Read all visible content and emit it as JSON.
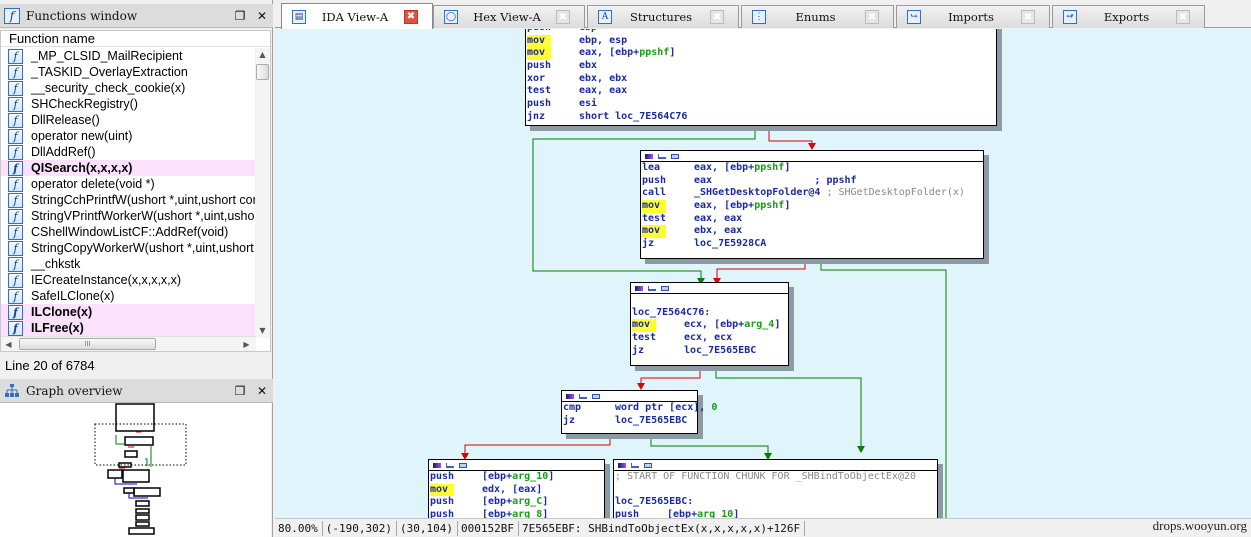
{
  "functions_window": {
    "title": "Functions window",
    "column_header": "Function name",
    "rows": [
      {
        "name": "_MP_CLSID_MailRecipient",
        "highlight": false
      },
      {
        "name": "_TASKID_OverlayExtraction",
        "highlight": false
      },
      {
        "name": "__security_check_cookie(x)",
        "highlight": false
      },
      {
        "name": "SHCheckRegistry()",
        "highlight": false
      },
      {
        "name": "DllRelease()",
        "highlight": false
      },
      {
        "name": "operator new(uint)",
        "highlight": false
      },
      {
        "name": "DllAddRef()",
        "highlight": false
      },
      {
        "name": "QISearch(x,x,x,x)",
        "highlight": true
      },
      {
        "name": "operator delete(void *)",
        "highlight": false
      },
      {
        "name": "StringCchPrintfW(ushort *,uint,ushort const *,...)",
        "highlight": false
      },
      {
        "name": "StringVPrintfWorkerW(ushort *,uint,ushort *,ushort const *,char *)",
        "highlight": false
      },
      {
        "name": "CShellWindowListCF::AddRef(void)",
        "highlight": false
      },
      {
        "name": "StringCopyWorkerW(ushort *,uint,ushort const *)",
        "highlight": false
      },
      {
        "name": "__chkstk",
        "highlight": false
      },
      {
        "name": "IECreateInstance(x,x,x,x,x)",
        "highlight": false
      },
      {
        "name": "SafeILClone(x)",
        "highlight": false
      },
      {
        "name": "ILClone(x)",
        "highlight": true
      },
      {
        "name": "ILFree(x)",
        "highlight": true
      }
    ],
    "status": "Line 20 of 6784",
    "icon": "function-icon"
  },
  "graph_overview": {
    "title": "Graph overview",
    "icon": "graph-tree-icon"
  },
  "tabs": [
    {
      "label": "IDA View-A",
      "icon": "ida-view-icon",
      "active": true
    },
    {
      "label": "Hex View-A",
      "icon": "hex-view-icon",
      "active": false
    },
    {
      "label": "Structures",
      "icon": "structures-icon",
      "active": false
    },
    {
      "label": "Enums",
      "icon": "enums-icon",
      "active": false
    },
    {
      "label": "Imports",
      "icon": "imports-icon",
      "active": false
    },
    {
      "label": "Exports",
      "icon": "exports-icon",
      "active": false
    }
  ],
  "graph": {
    "nodes": {
      "n1": {
        "lines": [
          {
            "mn": "push",
            "ops": [
              {
                "t": "ebp"
              }
            ]
          },
          {
            "mn": "mov",
            "ops": [
              {
                "t": "ebp, esp"
              }
            ]
          },
          {
            "mn": "mov",
            "ops": [
              {
                "t": "eax, [ebp+"
              },
              {
                "t": "ppshf",
                "c": "var"
              },
              {
                "t": "]"
              }
            ]
          },
          {
            "mn": "push",
            "ops": [
              {
                "t": "ebx"
              }
            ]
          },
          {
            "mn": "xor",
            "ops": [
              {
                "t": "ebx, ebx"
              }
            ]
          },
          {
            "mn": "test",
            "ops": [
              {
                "t": "eax, eax"
              }
            ]
          },
          {
            "mn": "push",
            "ops": [
              {
                "t": "esi"
              }
            ]
          },
          {
            "mn": "jnz",
            "ops": [
              {
                "t": "short loc_7E564C76"
              }
            ]
          }
        ]
      },
      "n2": {
        "lines": [
          {
            "mn": "lea",
            "ops": [
              {
                "t": "eax, [ebp+"
              },
              {
                "t": "ppshf",
                "c": "var"
              },
              {
                "t": "]"
              }
            ]
          },
          {
            "mn": "push",
            "ops": [
              {
                "t": "eax                 "
              },
              {
                "t": "; ppshf",
                "c": "op"
              }
            ]
          },
          {
            "mn": "call",
            "ops": [
              {
                "t": "_SHGetDesktopFolder@4 "
              },
              {
                "t": "; SHGetDesktopFolder(x)",
                "c": "cmt"
              }
            ]
          },
          {
            "mn": "mov",
            "ops": [
              {
                "t": "eax, [ebp+"
              },
              {
                "t": "ppshf",
                "c": "var"
              },
              {
                "t": "]"
              }
            ]
          },
          {
            "mn": "test",
            "ops": [
              {
                "t": "eax, eax"
              }
            ]
          },
          {
            "mn": "mov",
            "ops": [
              {
                "t": "ebx, eax"
              }
            ]
          },
          {
            "mn": "jz",
            "ops": [
              {
                "t": "loc_7E5928CA"
              }
            ]
          }
        ]
      },
      "n3": {
        "label": "loc_7E564C76:",
        "lines": [
          {
            "mn": "mov",
            "ops": [
              {
                "t": "ecx, [ebp+"
              },
              {
                "t": "arg_4",
                "c": "var"
              },
              {
                "t": "]"
              }
            ]
          },
          {
            "mn": "test",
            "ops": [
              {
                "t": "ecx, ecx"
              }
            ]
          },
          {
            "mn": "jz",
            "ops": [
              {
                "t": "loc_7E565EBC"
              }
            ]
          }
        ]
      },
      "n4": {
        "lines": [
          {
            "mn": "cmp",
            "ops": [
              {
                "t": "word ptr [ecx], "
              },
              {
                "t": "0",
                "c": "num"
              }
            ]
          },
          {
            "mn": "jz",
            "ops": [
              {
                "t": "loc_7E565EBC"
              }
            ]
          }
        ]
      },
      "n5": {
        "lines": [
          {
            "mn": "push",
            "ops": [
              {
                "t": "[ebp+"
              },
              {
                "t": "arg_10",
                "c": "var"
              },
              {
                "t": "]"
              }
            ]
          },
          {
            "mn": "mov",
            "ops": [
              {
                "t": "edx, [eax]"
              }
            ]
          },
          {
            "mn": "push",
            "ops": [
              {
                "t": "[ebp+"
              },
              {
                "t": "arg_C",
                "c": "var"
              },
              {
                "t": "]"
              }
            ]
          },
          {
            "mn": "push",
            "ops": [
              {
                "t": "[ebp+"
              },
              {
                "t": "arg_8",
                "c": "var"
              },
              {
                "t": "]"
              }
            ]
          }
        ]
      },
      "n6": {
        "comment": "; START OF FUNCTION CHUNK FOR _SHBindToObjectEx@20",
        "label": "loc_7E565EBC:",
        "lines": [
          {
            "mn": "push",
            "ops": [
              {
                "t": "[ebp+"
              },
              {
                "t": "arg_10",
                "c": "var"
              },
              {
                "t": "]"
              }
            ]
          }
        ]
      }
    }
  },
  "status_bar": {
    "zoom": "80.00%",
    "graph_coords": "(-190,302)",
    "node_coords": "(30,104)",
    "file_offset": "000152BF",
    "location": "7E565EBF: SHBindToObjectEx(x,x,x,x,x)+126F"
  },
  "watermark": "drops.wooyun.org",
  "colors": {
    "graph_bg": "#dff4fb",
    "edge_true": "#008000",
    "edge_false": "#e00000",
    "edge_uncond": "#0000c0",
    "highlight_row": "#fbe1fb",
    "mov_highlight": "#ffff30"
  }
}
